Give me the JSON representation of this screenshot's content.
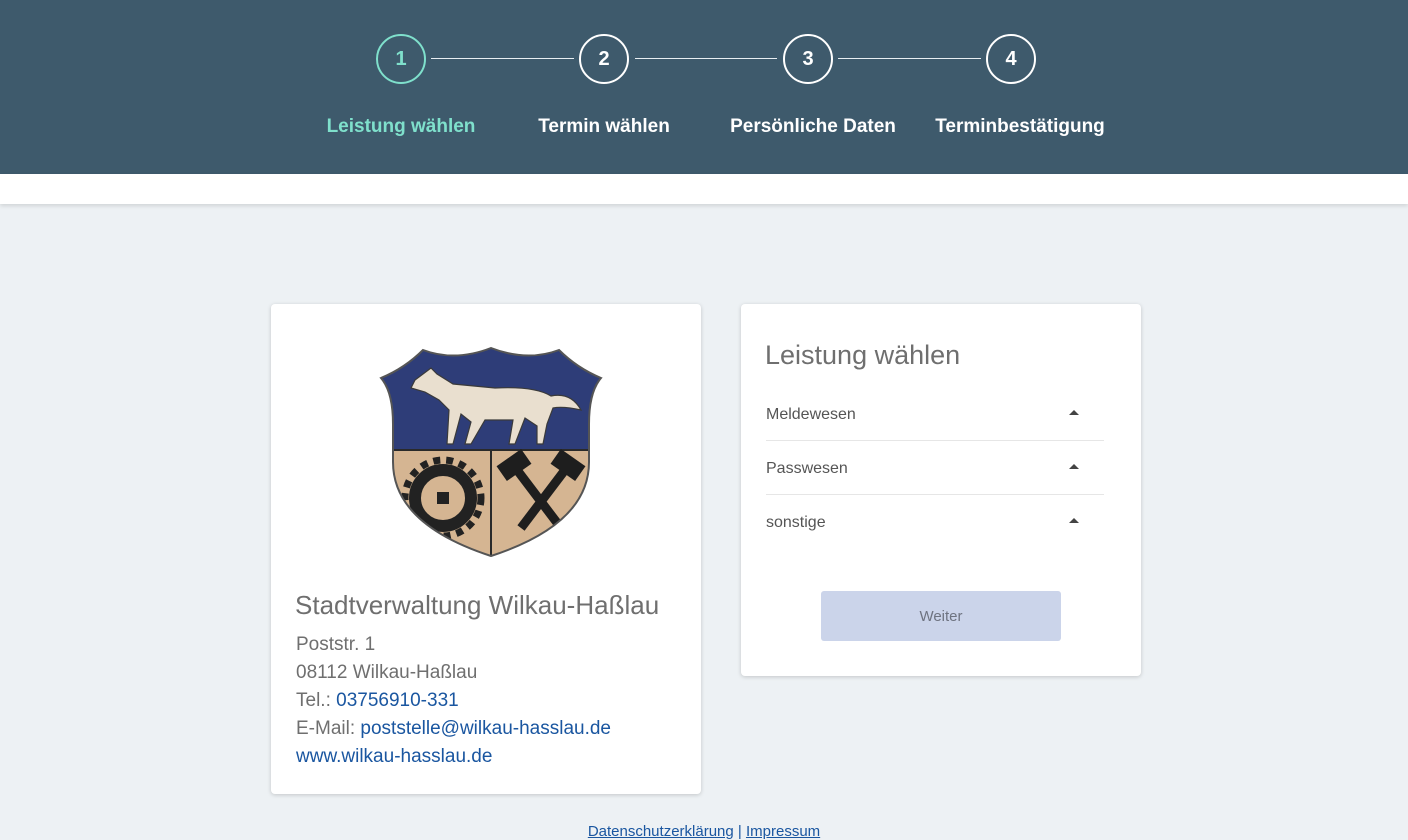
{
  "stepper": {
    "steps": [
      {
        "number": "1",
        "label": "Leistung wählen",
        "active": true
      },
      {
        "number": "2",
        "label": "Termin wählen",
        "active": false
      },
      {
        "number": "3",
        "label": "Persönliche Daten",
        "active": false
      },
      {
        "number": "4",
        "label": "Terminbestätigung",
        "active": false
      }
    ],
    "active_color": "#7fe0cc",
    "header_color": "#3e5a6c"
  },
  "office": {
    "name": "Stadtverwaltung Wilkau-Haßlau",
    "street": "Poststr. 1",
    "city": "08112 Wilkau-Haßlau",
    "phone_label": "Tel.:",
    "phone": "03756910-331",
    "email_label": "E-Mail:",
    "email": "poststelle@wilkau-hasslau.de",
    "website": "www.wilkau-hasslau.de",
    "logo_icon": "coat-of-arms-wolf-gear-hammers"
  },
  "services": {
    "title": "Leistung wählen",
    "categories": [
      "Meldewesen",
      "Passwesen",
      "sonstige"
    ],
    "next_button": "Weiter"
  },
  "footer": {
    "privacy": "Datenschutzerklärung",
    "separator": "|",
    "imprint": "Impressum"
  }
}
